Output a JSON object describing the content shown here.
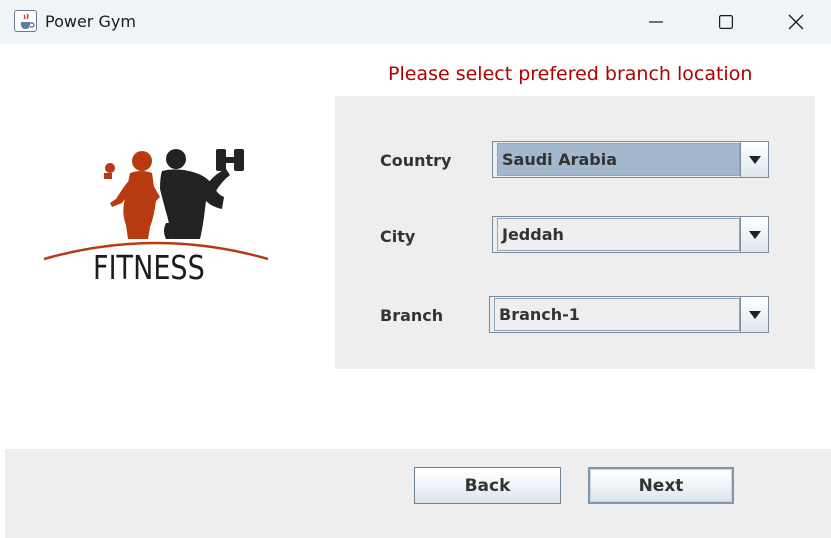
{
  "window": {
    "title": "Power Gym",
    "icon": "java-coffee-cup-icon",
    "controls": [
      "minimize-icon",
      "maximize-icon",
      "close-icon"
    ]
  },
  "logo": {
    "text": "FITNESS",
    "figure_colors": {
      "woman": "#b83a10",
      "man": "#222222",
      "arc": "#b83a10"
    }
  },
  "prompt": "Please select prefered branch location",
  "form": {
    "country": {
      "label": "Country",
      "value": "Saudi Arabia"
    },
    "city": {
      "label": "City",
      "value": "Jeddah"
    },
    "branch": {
      "label": "Branch",
      "value": "Branch-1"
    }
  },
  "buttons": {
    "back": "Back",
    "next": "Next"
  },
  "colors": {
    "prompt": "#b00000",
    "panel": "#eeeeee",
    "selected_combo": "#a3b8cc"
  }
}
